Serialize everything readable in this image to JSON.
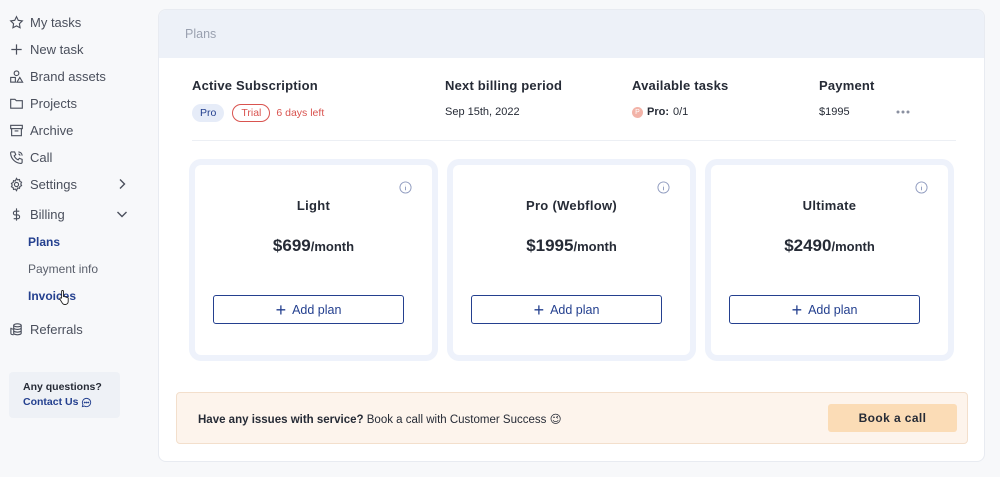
{
  "sidebar": {
    "items": [
      {
        "label": "My tasks",
        "icon": "star-icon"
      },
      {
        "label": "New task",
        "icon": "plus-icon"
      },
      {
        "label": "Brand assets",
        "icon": "shapes-icon"
      },
      {
        "label": "Projects",
        "icon": "folder-icon"
      },
      {
        "label": "Archive",
        "icon": "archive-icon"
      },
      {
        "label": "Call",
        "icon": "phone-icon"
      },
      {
        "label": "Settings",
        "icon": "gear-icon"
      },
      {
        "label": "Billing",
        "icon": "dollar-icon"
      },
      {
        "label": "Referrals",
        "icon": "coins-icon"
      }
    ],
    "billing_sub": [
      {
        "label": "Plans"
      },
      {
        "label": "Payment info"
      },
      {
        "label": "Invoices"
      }
    ],
    "questions": {
      "title": "Any questions?",
      "contact": "Contact Us"
    }
  },
  "main": {
    "header": "Plans",
    "subscription": {
      "active_label": "Active Subscription",
      "plan_badge": "Pro",
      "trial_badge": "Trial",
      "days_left": "6 days left",
      "billing_label": "Next billing period",
      "billing_value": "Sep 15th, 2022",
      "tasks_label": "Available tasks",
      "tasks_plan": "Pro:",
      "tasks_value": "0/1",
      "payment_label": "Payment",
      "payment_value": "$1995"
    },
    "plans": [
      {
        "name": "Light",
        "price": "$699",
        "period": "/month",
        "button": "Add plan"
      },
      {
        "name": "Pro (Webflow)",
        "price": "$1995",
        "period": "/month",
        "button": "Add plan"
      },
      {
        "name": "Ultimate",
        "price": "$2490",
        "period": "/month",
        "button": "Add plan"
      }
    ],
    "banner": {
      "bold": "Have any issues with service?",
      "text": "Book a call with Customer Success",
      "emoji": "😉",
      "button": "Book a call"
    }
  },
  "colors": {
    "accent": "#24408f",
    "danger": "#d9534f",
    "banner_bg": "#fdf4ec",
    "banner_button": "#fbdcb6"
  }
}
